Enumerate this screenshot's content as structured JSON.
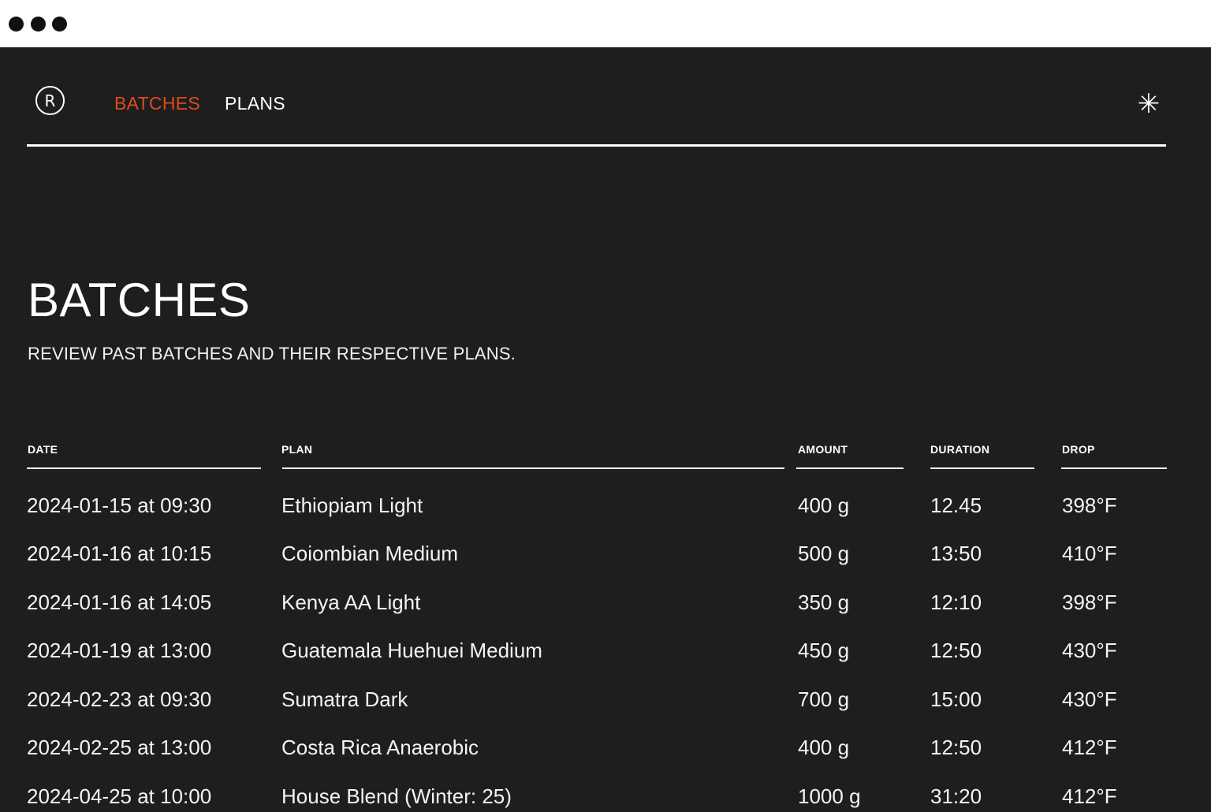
{
  "logo": {
    "glyph": "R"
  },
  "nav": {
    "items": [
      {
        "label": "BATCHES",
        "active": true
      },
      {
        "label": "PLANS",
        "active": false
      }
    ],
    "theme_toggle_icon": "asterisk-icon",
    "active_color": "#e04a1c"
  },
  "page": {
    "title": "BATCHES",
    "subtitle": "REVIEW PAST BATCHES AND THEIR RESPECTIVE PLANS."
  },
  "table": {
    "columns": [
      "DATE",
      "PLAN",
      "AMOUNT",
      "DURATION",
      "DROP"
    ],
    "rows": [
      [
        "2024-01-15 at 09:30",
        "Ethiopiam Light",
        "400 g",
        "12.45",
        "398°F"
      ],
      [
        "2024-01-16 at 10:15",
        "Coiombian Medium",
        "500 g",
        "13:50",
        "410°F"
      ],
      [
        "2024-01-16 at 14:05",
        "Kenya AA Light",
        "350 g",
        "12:10",
        "398°F"
      ],
      [
        "2024-01-19 at 13:00",
        "Guatemala Huehuei Medium",
        "450 g",
        "12:50",
        "430°F"
      ],
      [
        "2024-02-23 at 09:30",
        "Sumatra Dark",
        "700 g",
        "15:00",
        "430°F"
      ],
      [
        "2024-02-25 at 13:00",
        "Costa Rica Anaerobic",
        "400 g",
        "12:50",
        "412°F"
      ],
      [
        "2024-04-25 at 10:00",
        "House Blend (Winter: 25)",
        "1000 g",
        "31:20",
        "412°F"
      ]
    ]
  }
}
